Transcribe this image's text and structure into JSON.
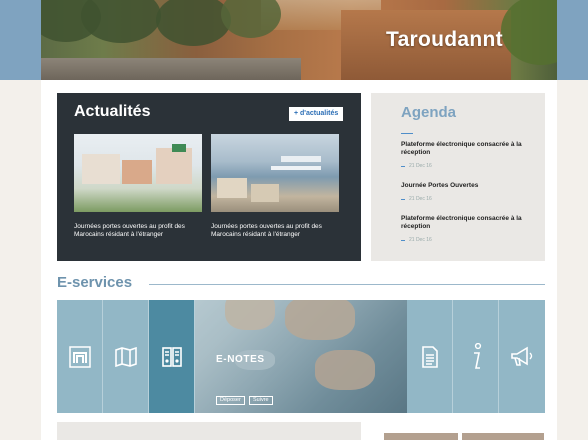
{
  "hero": {
    "title": "Taroudannt"
  },
  "news": {
    "title": "Actualités",
    "more_label": "+ d'actualités",
    "items": [
      {
        "caption": "Journées portes ouvertes au profit des Marocains résidant à l'étranger"
      },
      {
        "caption": "Journées portes ouvertes au profit des Marocains résidant à l'étranger"
      }
    ]
  },
  "agenda": {
    "title": "Agenda",
    "events": [
      {
        "title": "Plateforme électronique consacrée à la réception",
        "date": "21 Dec 16"
      },
      {
        "title": "Journée Portes Ouvertes",
        "date": "21 Dec 16"
      },
      {
        "title": "Plateforme électronique consacrée à la réception",
        "date": "21 Dec 16"
      }
    ]
  },
  "eservices": {
    "title": "E-services",
    "featured": {
      "label": "E-NOTES",
      "deposit": "Déposer",
      "follow": "Suivre"
    },
    "icons": [
      "n-logo-icon",
      "map-icon",
      "documents-icon",
      "document-icon",
      "info-icon",
      "megaphone-icon"
    ]
  },
  "colors": {
    "accent": "#4f8ec9",
    "eservices_bg": "#92b7c6",
    "eservices_active": "#4d8aa1",
    "news_bg": "#2b3238"
  }
}
